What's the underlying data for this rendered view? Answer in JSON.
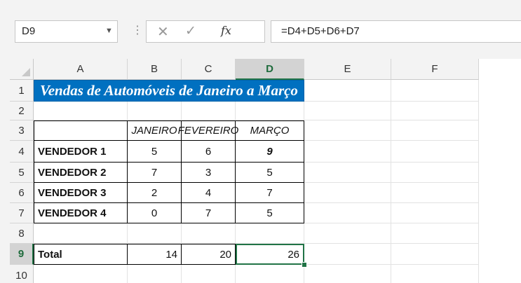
{
  "formula_bar": {
    "name_box": "D9",
    "formula": "=D4+D5+D6+D7",
    "fx": "fx"
  },
  "columns": [
    "A",
    "B",
    "C",
    "D",
    "E",
    "F"
  ],
  "rows": [
    "1",
    "2",
    "3",
    "4",
    "5",
    "6",
    "7",
    "8",
    "9",
    "10"
  ],
  "selected_cell": {
    "column": "D",
    "row": "9"
  },
  "title": "Vendas de Automóveis de Janeiro a Março",
  "months": [
    "JANEIRO",
    "FEVEREIRO",
    "MARÇO"
  ],
  "sellers": [
    "VENDEDOR 1",
    "VENDEDOR 2",
    "VENDEDOR 3",
    "VENDEDOR 4"
  ],
  "values": [
    [
      "5",
      "6",
      "9"
    ],
    [
      "7",
      "3",
      "5"
    ],
    [
      "2",
      "4",
      "7"
    ],
    [
      "0",
      "7",
      "5"
    ]
  ],
  "total": {
    "label": "Total",
    "values": [
      "14",
      "20",
      "26"
    ]
  },
  "colors": {
    "title_fill": "#0070c0",
    "selection": "#217346"
  }
}
